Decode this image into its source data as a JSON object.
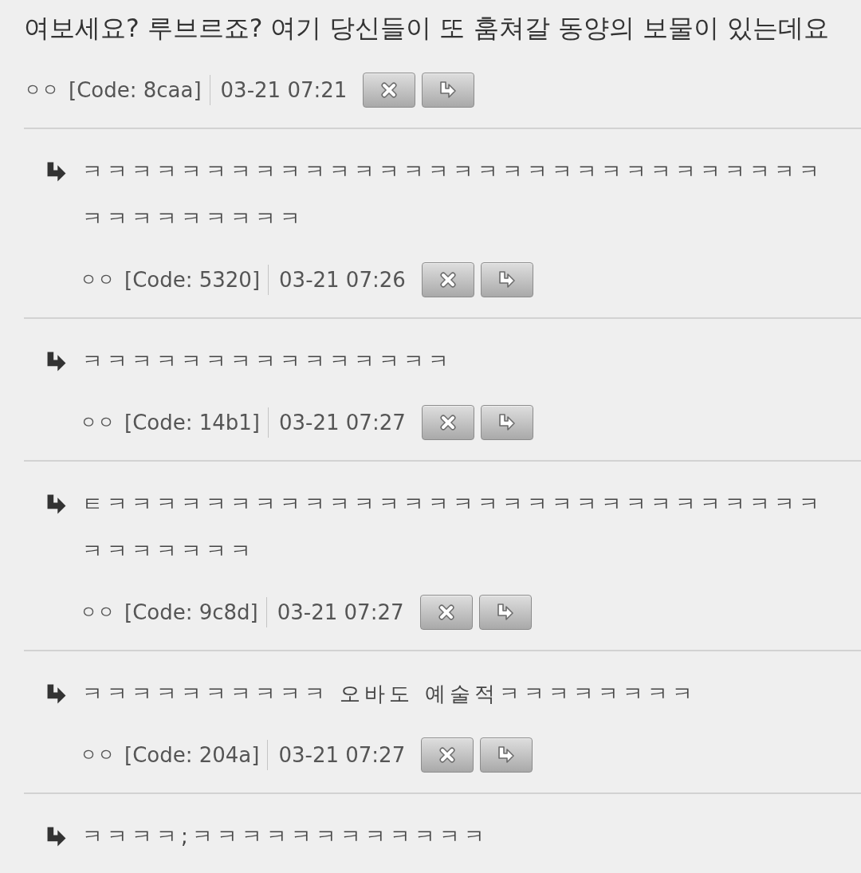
{
  "post": {
    "text": "여보세요? 루브르죠? 여기 당신들이 또 훔쳐갈 동양의 보물이 있는데요",
    "author": "ㅇㅇ",
    "code": "[Code: 8caa]",
    "time": "03-21 07:21"
  },
  "replies": [
    {
      "text": "ㅋㅋㅋㅋㅋㅋㅋㅋㅋㅋㅋㅋㅋㅋㅋㅋㅋㅋㅋㅋㅋㅋㅋㅋㅋㅋㅋㅋㅋㅋㅋㅋㅋㅋㅋㅋㅋㅋㅋ",
      "author": "ㅇㅇ",
      "code": "[Code: 5320]",
      "time": "03-21 07:26"
    },
    {
      "text": "ㅋㅋㅋㅋㅋㅋㅋㅋㅋㅋㅋㅋㅋㅋㅋ",
      "author": "ㅇㅇ",
      "code": "[Code: 14b1]",
      "time": "03-21 07:27"
    },
    {
      "text": "ㅌㅋㅋㅋㅋㅋㅋㅋㅋㅋㅋㅋㅋㅋㅋㅋㅋㅋㅋㅋㅋㅋㅋㅋㅋㅋㅋㅋㅋㅋㅋㅋㅋㅋㅋㅋㅋ",
      "author": "ㅇㅇ",
      "code": "[Code: 9c8d]",
      "time": "03-21 07:27"
    },
    {
      "text": "ㅋㅋㅋㅋㅋㅋㅋㅋㅋㅋ 오바도 예술적ㅋㅋㅋㅋㅋㅋㅋㅋ",
      "author": "ㅇㅇ",
      "code": "[Code: 204a]",
      "time": "03-21 07:27"
    },
    {
      "text": "ㅋㅋㅋㅋ;ㅋㅋㅋㅋㅋㅋㅋㅋㅋㅋㅋㅋ"
    }
  ]
}
